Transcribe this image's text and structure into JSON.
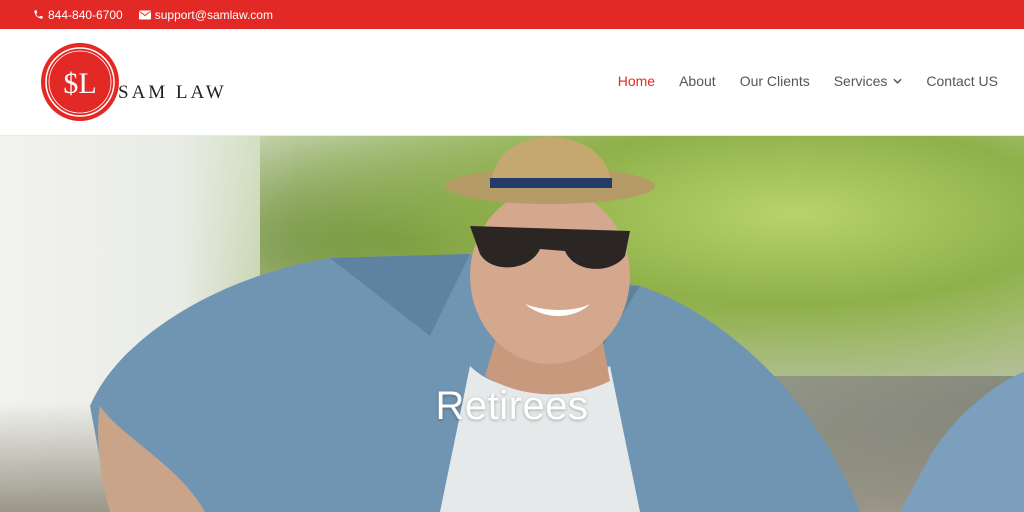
{
  "topbar": {
    "phone": "844-840-6700",
    "email": "support@samlaw.com",
    "background": "#e32925"
  },
  "header": {
    "logo_text": "SAM LAW",
    "logo_monogram": "$L"
  },
  "nav": {
    "items": [
      {
        "label": "Home",
        "active": true
      },
      {
        "label": "About"
      },
      {
        "label": "Our Clients"
      },
      {
        "label": "Services",
        "dropdown": true
      },
      {
        "label": "Contact US"
      }
    ],
    "active_color": "#e32925"
  },
  "hero": {
    "title": "Retirees",
    "image": "man-in-straw-hat-and-sunglasses"
  }
}
